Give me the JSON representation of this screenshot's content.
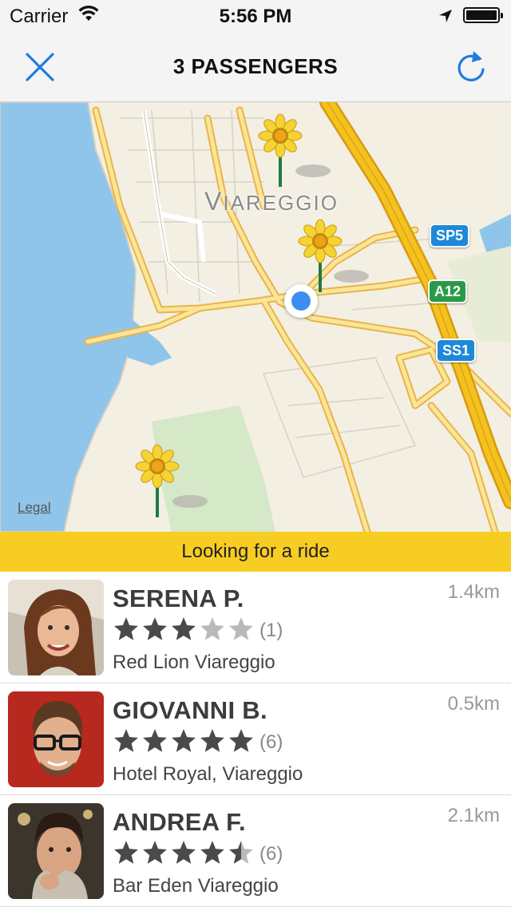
{
  "status_bar": {
    "carrier": "Carrier",
    "time": "5:56 PM"
  },
  "nav": {
    "title": "3 PASSENGERS",
    "close_icon": "close-icon",
    "refresh_icon": "refresh-icon"
  },
  "colors": {
    "accent": "#1e7ce0",
    "banner": "#f7cd24",
    "water": "#8cc3e9",
    "road": "#f3c54c",
    "highway": "#f2b21a",
    "star_filled": "#4a4a4a",
    "star_empty": "#b9b9b9"
  },
  "map": {
    "city": "VIAREGGIO",
    "legal": "Legal",
    "road_shields": [
      "SP5",
      "A12",
      "SS1"
    ],
    "pins": 3,
    "user_location_icon": "user-location-dot"
  },
  "banner": {
    "text": "Looking for a ride"
  },
  "passengers": [
    {
      "name": "SERENA P.",
      "distance": "1.4km",
      "rating": 3,
      "reviews": "(1)",
      "location": "Red Lion Viareggio"
    },
    {
      "name": "GIOVANNI B.",
      "distance": "0.5km",
      "rating": 5,
      "reviews": "(6)",
      "location": "Hotel Royal, Viareggio"
    },
    {
      "name": "ANDREA F.",
      "distance": "2.1km",
      "rating": 4.5,
      "reviews": "(6)",
      "location": "Bar Eden Viareggio"
    }
  ]
}
